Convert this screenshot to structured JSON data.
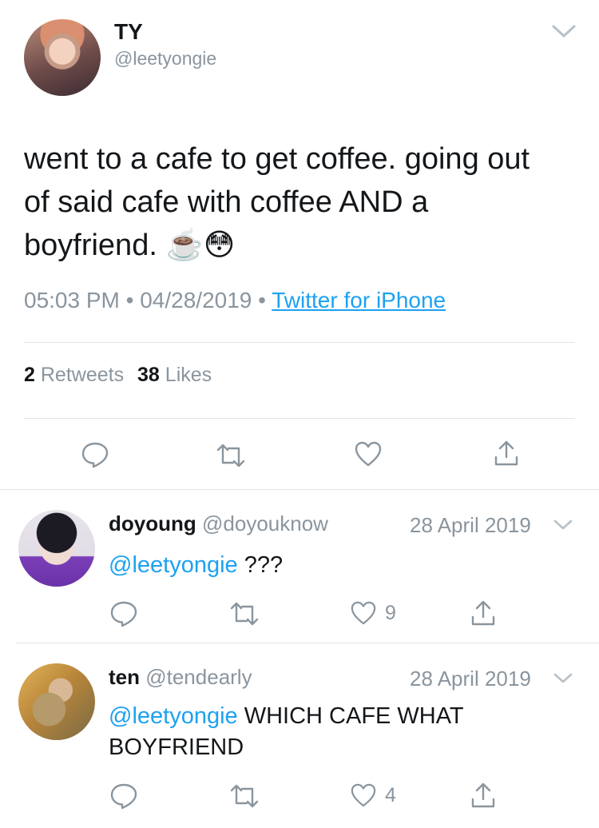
{
  "main_tweet": {
    "display_name": "TY",
    "handle": "@leetyongie",
    "text": "went to a cafe to get coffee. going out of said cafe with coffee AND a boyfriend. ☕️😳",
    "time": "05:03 PM",
    "date": "04/28/2019",
    "separator": "•",
    "source": "Twitter for iPhone",
    "retweets_count": "2",
    "retweets_label": "Retweets",
    "likes_count": "38",
    "likes_label": "Likes"
  },
  "replies": [
    {
      "display_name": "doyoung",
      "handle": "@doyouknow",
      "date": "28 April 2019",
      "mention": "@leetyongie",
      "text": " ???",
      "like_count": "9"
    },
    {
      "display_name": "ten",
      "handle": "@tendearly",
      "date": "28 April 2019",
      "mention": "@leetyongie",
      "text": " WHICH CAFE WHAT BOYFRIEND",
      "like_count": "4"
    }
  ],
  "icons": {
    "menu": "chevron-down-icon",
    "reply": "reply-icon",
    "retweet": "retweet-icon",
    "like": "heart-icon",
    "share": "share-icon"
  },
  "colors": {
    "link": "#1da1f2",
    "secondary_text": "#8a959e",
    "divider": "#e1e4e8"
  }
}
